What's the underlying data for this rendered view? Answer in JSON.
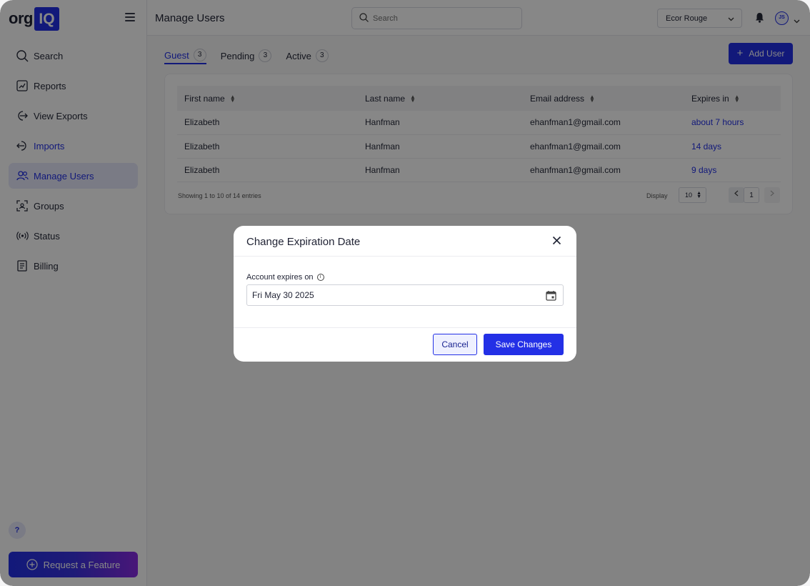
{
  "brand": {
    "org": "org",
    "iq": "IQ",
    "accent": "#2330e6"
  },
  "sidebar": {
    "items": [
      {
        "label": "Search",
        "icon": "search-icon"
      },
      {
        "label": "Reports",
        "icon": "reports-icon"
      },
      {
        "label": "View Exports",
        "icon": "export-icon"
      },
      {
        "label": "Imports",
        "icon": "import-icon"
      },
      {
        "label": "Manage Users",
        "icon": "users-icon"
      },
      {
        "label": "Groups",
        "icon": "groups-icon"
      },
      {
        "label": "Status",
        "icon": "status-icon"
      },
      {
        "label": "Billing",
        "icon": "billing-icon"
      }
    ],
    "help": "?",
    "request_feature": "Request a Feature"
  },
  "topbar": {
    "title": "Manage Users",
    "search_placeholder": "Search",
    "org_selected": "Ecor Rouge",
    "avatar_initials": "JS"
  },
  "tabs": [
    {
      "label": "Guest",
      "count": "3"
    },
    {
      "label": "Pending",
      "count": "3"
    },
    {
      "label": "Active",
      "count": "3"
    }
  ],
  "add_user": "Add User",
  "table": {
    "columns": [
      "First name",
      "Last name",
      "Email address",
      "Expires in"
    ],
    "rows": [
      [
        "Elizabeth",
        "Hanfman",
        "ehanfman1@gmail.com",
        "about 7 hours"
      ],
      [
        "Elizabeth",
        "Hanfman",
        "ehanfman1@gmail.com",
        "14 days"
      ],
      [
        "Elizabeth",
        "Hanfman",
        "ehanfman1@gmail.com",
        "9 days"
      ]
    ],
    "showing": "Showing 1 to 10 of 14 entries",
    "display_label": "Display",
    "display_value": "10",
    "page": "1"
  },
  "modal": {
    "title": "Change Expiration Date",
    "field_label": "Account expires on",
    "date_value": "Fri May 30 2025",
    "cancel": "Cancel",
    "save": "Save Changes"
  }
}
